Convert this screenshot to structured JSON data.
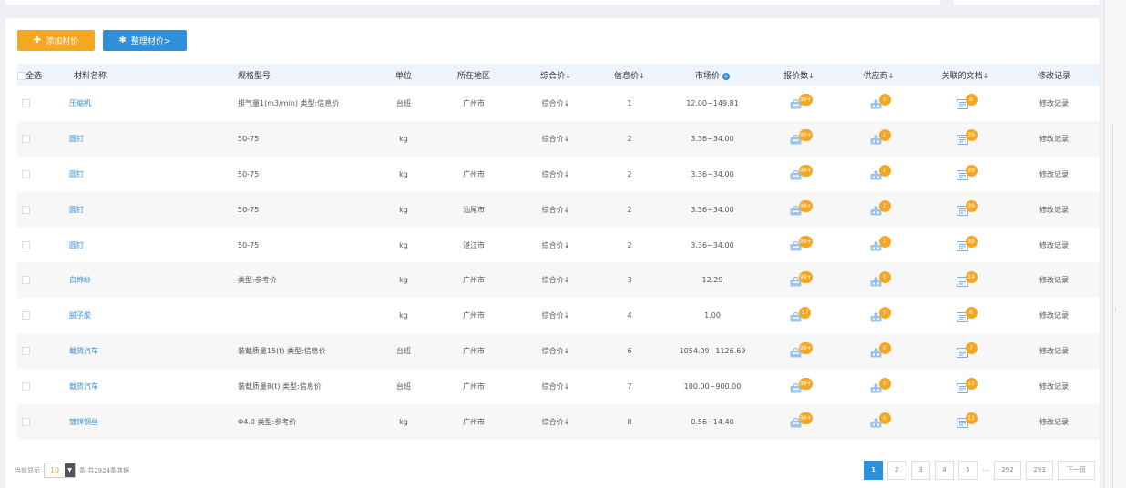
{
  "toolbar": {
    "add_label": "添加材价",
    "sort_label": "整理材价>"
  },
  "columns": {
    "select_all": "全选",
    "name": "材料名称",
    "spec": "规格型号",
    "unit": "单位",
    "region": "所在地区",
    "composite": "综合价",
    "info": "信息价",
    "market": "市场价",
    "quotes": "报价数",
    "suppliers": "供应商",
    "docs": "关联的文档",
    "history": "修改记录"
  },
  "rows": [
    {
      "name": "压缩机",
      "spec": "排气量1(m3/min) 类型:信息价",
      "unit": "台班",
      "region": "广州市",
      "composite": "综合价",
      "info": "1",
      "market": "12.00~149.81",
      "quotes": "99+",
      "suppliers": "0",
      "docs": "8",
      "history": "修改记录"
    },
    {
      "name": "圆钉",
      "spec": "50-75",
      "unit": "kg",
      "region": "",
      "composite": "综合价",
      "info": "2",
      "market": "3.36~34.00",
      "quotes": "99+",
      "suppliers": "2",
      "docs": "39",
      "history": "修改记录"
    },
    {
      "name": "圆钉",
      "spec": "50-75",
      "unit": "kg",
      "region": "广州市",
      "composite": "综合价",
      "info": "2",
      "market": "3.36~34.00",
      "quotes": "99+",
      "suppliers": "2",
      "docs": "39",
      "history": "修改记录"
    },
    {
      "name": "圆钉",
      "spec": "50-75",
      "unit": "kg",
      "region": "汕尾市",
      "composite": "综合价",
      "info": "2",
      "market": "3.36~34.00",
      "quotes": "99+",
      "suppliers": "2",
      "docs": "39",
      "history": "修改记录"
    },
    {
      "name": "圆钉",
      "spec": "50-75",
      "unit": "kg",
      "region": "湛江市",
      "composite": "综合价",
      "info": "2",
      "market": "3.36~34.00",
      "quotes": "99+",
      "suppliers": "2",
      "docs": "39",
      "history": "修改记录"
    },
    {
      "name": "白棉纱",
      "spec": "类型:参考价",
      "unit": "kg",
      "region": "广州市",
      "composite": "综合价",
      "info": "3",
      "market": "12.29",
      "quotes": "99+",
      "suppliers": "0",
      "docs": "14",
      "history": "修改记录"
    },
    {
      "name": "腻子胶",
      "spec": "",
      "unit": "kg",
      "region": "广州市",
      "composite": "综合价",
      "info": "4",
      "market": "1.00",
      "quotes": "17",
      "suppliers": "0",
      "docs": "6",
      "history": "修改记录"
    },
    {
      "name": "载货汽车",
      "spec": "装载质量15(t) 类型:信息价",
      "unit": "台班",
      "region": "广州市",
      "composite": "综合价",
      "info": "6",
      "market": "1054.09~1126.69",
      "quotes": "99+",
      "suppliers": "0",
      "docs": "7",
      "history": "修改记录"
    },
    {
      "name": "载货汽车",
      "spec": "装载质量8(t) 类型:信息价",
      "unit": "台班",
      "region": "广州市",
      "composite": "综合价",
      "info": "7",
      "market": "100.00~900.00",
      "quotes": "99+",
      "suppliers": "0",
      "docs": "12",
      "history": "修改记录"
    },
    {
      "name": "镀锌钢丝",
      "spec": "Φ4.0 类型:参考价",
      "unit": "kg",
      "region": "广州市",
      "composite": "综合价",
      "info": "8",
      "market": "0.56~14.40",
      "quotes": "99+",
      "suppliers": "0",
      "docs": "13",
      "history": "修改记录"
    }
  ],
  "footer": {
    "showing_label": "当前显示",
    "page_size": "10",
    "total_text": "条 共2924条数据",
    "pages": [
      "1",
      "2",
      "3",
      "4",
      "5",
      "...",
      "292",
      "293"
    ],
    "current_page": "1",
    "next_label": "下一页"
  },
  "icons": {
    "add": "plus-icon",
    "sort": "gear-icon",
    "quotes": "bag-icon",
    "suppliers": "supplier-icon",
    "docs": "document-icon",
    "market_info": "plus-circle-icon"
  },
  "colors": {
    "accent_blue": "#2f8fdb",
    "accent_orange": "#f5a623",
    "header_bg": "#edf4fb"
  }
}
